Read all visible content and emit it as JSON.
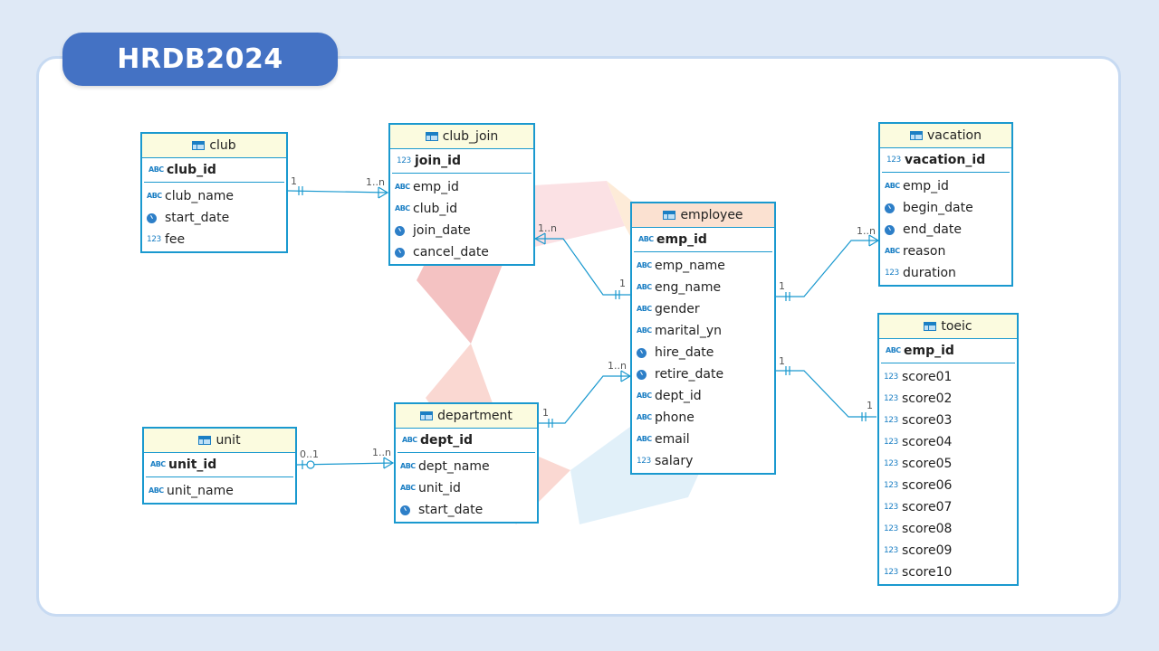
{
  "title": "HRDB2024",
  "tables": {
    "club": {
      "name": "club",
      "key": "club_id",
      "columns": [
        "club_name",
        "start_date",
        "fee"
      ]
    },
    "club_join": {
      "name": "club_join",
      "key": "join_id",
      "columns": [
        "emp_id",
        "club_id",
        "join_date",
        "cancel_date"
      ]
    },
    "employee": {
      "name": "employee",
      "key": "emp_id",
      "columns": [
        "emp_name",
        "eng_name",
        "gender",
        "marital_yn",
        "hire_date",
        "retire_date",
        "dept_id",
        "phone",
        "email",
        "salary"
      ]
    },
    "vacation": {
      "name": "vacation",
      "key": "vacation_id",
      "columns": [
        "emp_id",
        "begin_date",
        "end_date",
        "reason",
        "duration"
      ]
    },
    "toeic": {
      "name": "toeic",
      "key": "emp_id",
      "columns": [
        "score01",
        "score02",
        "score03",
        "score04",
        "score05",
        "score06",
        "score07",
        "score08",
        "score09",
        "score10"
      ]
    },
    "unit": {
      "name": "unit",
      "key": "unit_id",
      "columns": [
        "unit_name"
      ]
    },
    "department": {
      "name": "department",
      "key": "dept_id",
      "columns": [
        "dept_name",
        "unit_id",
        "start_date"
      ]
    }
  },
  "relations": [
    {
      "from": "club",
      "to": "club_join",
      "from_card": "1",
      "to_card": "1..n"
    },
    {
      "from": "employee",
      "to": "club_join",
      "from_card": "1",
      "to_card": "1..n"
    },
    {
      "from": "employee",
      "to": "vacation",
      "from_card": "1",
      "to_card": "1..n"
    },
    {
      "from": "employee",
      "to": "toeic",
      "from_card": "1",
      "to_card": "1"
    },
    {
      "from": "department",
      "to": "employee",
      "from_card": "1",
      "to_card": "1..n"
    },
    {
      "from": "unit",
      "to": "department",
      "from_card": "0..1",
      "to_card": "1..n"
    }
  ],
  "colors": {
    "accent": "#4472c4",
    "border": "#1a99cf",
    "header": "#fbfbdf",
    "employee_header": "#fbe1d1"
  }
}
